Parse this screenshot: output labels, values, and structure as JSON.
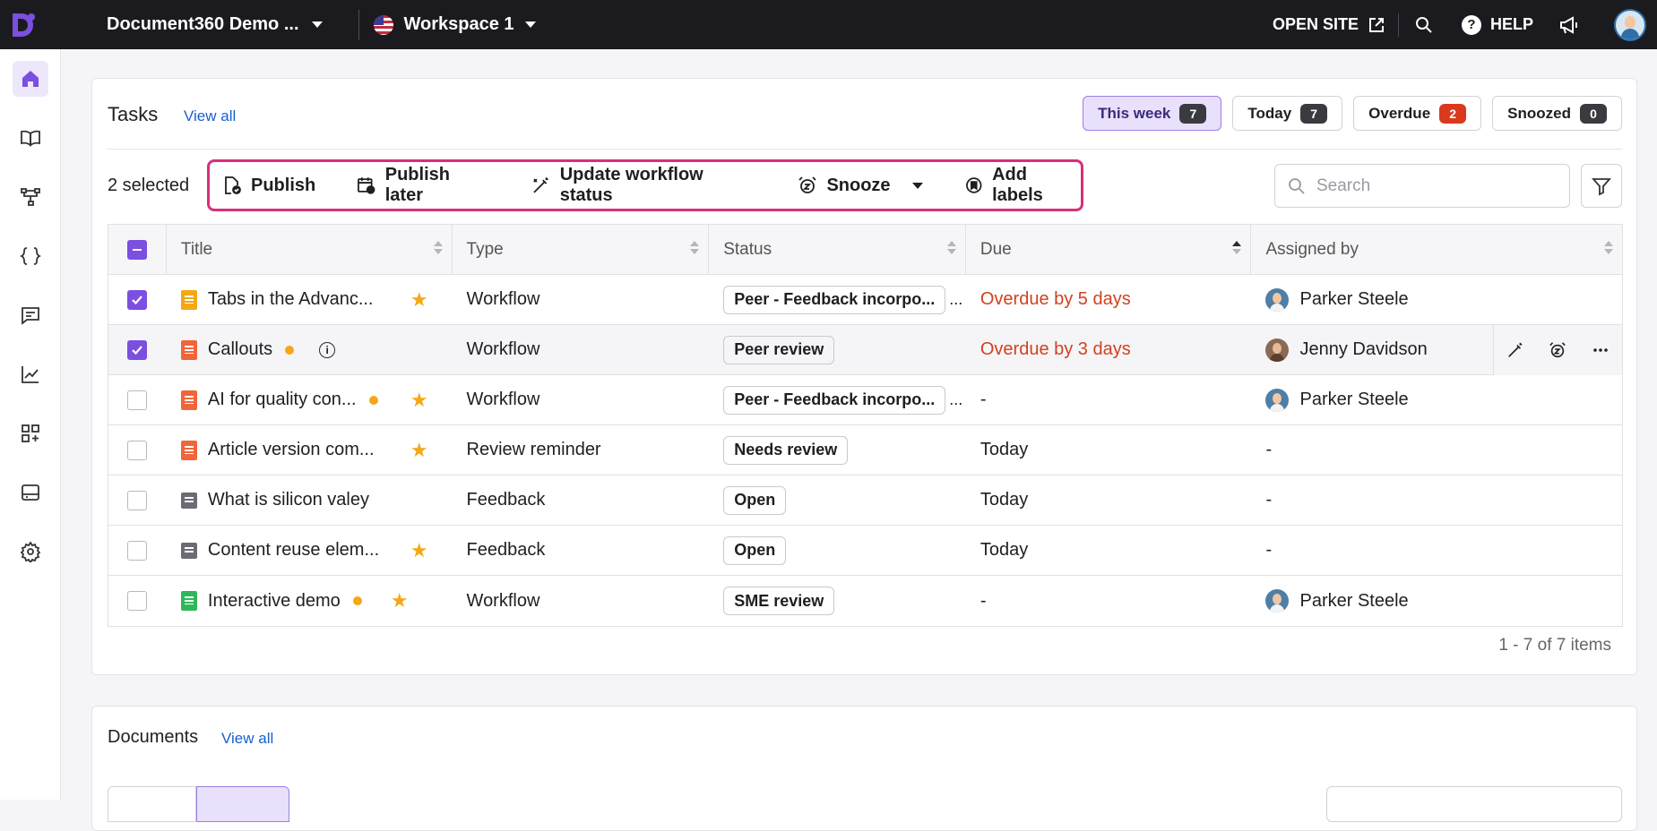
{
  "topbar": {
    "project_name": "Document360 Demo ...",
    "workspace": "Workspace 1",
    "open_site": "OPEN SITE",
    "help": "HELP"
  },
  "sidebar": {
    "items": [
      "home-icon",
      "book-icon",
      "category-tree-icon",
      "api-braces-icon",
      "feedback-icon",
      "analytics-icon",
      "apps-icon",
      "widget-icon",
      "settings-icon"
    ]
  },
  "tasks": {
    "title": "Tasks",
    "view_all": "View all",
    "filters": [
      {
        "label": "This week",
        "count": "7"
      },
      {
        "label": "Today",
        "count": "7"
      },
      {
        "label": "Overdue",
        "count": "2"
      },
      {
        "label": "Snoozed",
        "count": "0"
      }
    ],
    "selected_label": "2 selected",
    "bulk_actions": {
      "publish": "Publish",
      "publish_later": "Publish later",
      "update_workflow": "Update workflow status",
      "snooze": "Snooze",
      "add_labels": "Add labels"
    },
    "search_placeholder": "Search",
    "columns": [
      "Title",
      "Type",
      "Status",
      "Due",
      "Assigned by"
    ],
    "rows": [
      {
        "title": "Tabs in the Advanc...",
        "type": "Workflow",
        "status": "Peer - Feedback incorpo...",
        "due": "Overdue by 5 days",
        "assigned": "Parker Steele"
      },
      {
        "title": "Callouts",
        "type": "Workflow",
        "status": "Peer review",
        "due": "Overdue by 3 days",
        "assigned": "Jenny Davidson"
      },
      {
        "title": "AI for quality con...",
        "type": "Workflow",
        "status": "Peer - Feedback incorpo...",
        "due": "-",
        "assigned": "Parker Steele"
      },
      {
        "title": "Article version com...",
        "type": "Review reminder",
        "status": "Needs review",
        "due": "Today",
        "assigned": "-"
      },
      {
        "title": "What is silicon valey",
        "type": "Feedback",
        "status": "Open",
        "due": "Today",
        "assigned": "-"
      },
      {
        "title": "Content reuse elem...",
        "type": "Feedback",
        "status": "Open",
        "due": "Today",
        "assigned": "-"
      },
      {
        "title": "Interactive demo",
        "type": "Workflow",
        "status": "SME review",
        "due": "-",
        "assigned": "Parker Steele"
      }
    ],
    "pager": "1 - 7 of 7 items"
  },
  "documents": {
    "title": "Documents",
    "view_all": "View all"
  },
  "colors": {
    "accent": "#7b4fdf",
    "overdue": "#d2401e",
    "highlight_border": "#d6307a",
    "star": "#f4a815"
  }
}
